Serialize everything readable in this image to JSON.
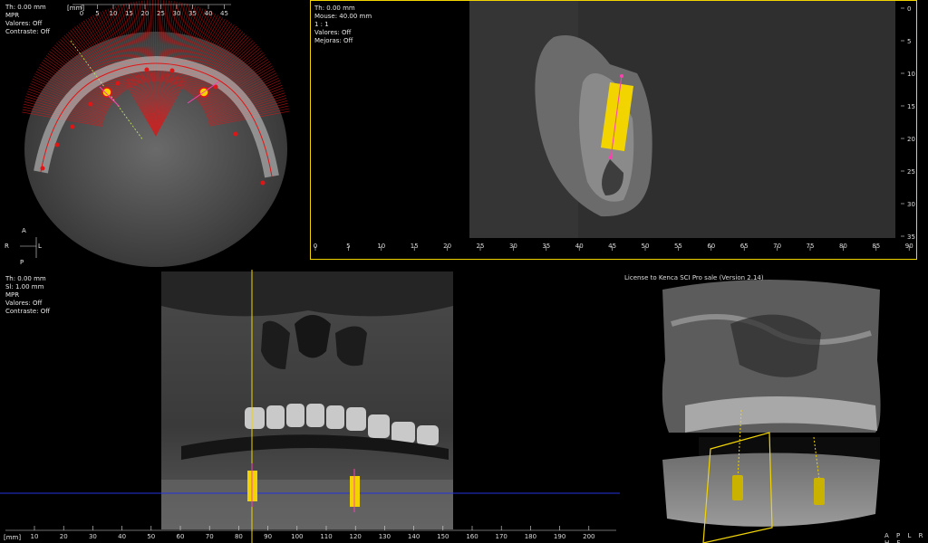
{
  "axial": {
    "info": [
      "Th: 0.00 mm",
      "MPR",
      "Valores: Off",
      "Contraste: Off"
    ],
    "ruler_unit": "[mm]",
    "ruler_ticks": [
      "0",
      "5",
      "10",
      "15",
      "20",
      "25",
      "30",
      "35",
      "40",
      "45"
    ],
    "orientation": {
      "top": "A",
      "left": "R",
      "right": "L",
      "bottom": "P"
    }
  },
  "cross": {
    "info": [
      "Th: 0.00 mm",
      "Mouse: 40.00 mm",
      "1 : 1",
      "Valores: Off",
      "Mejoras: Off"
    ],
    "h_ticks": [
      "0",
      "5",
      "10",
      "15",
      "20",
      "25",
      "30",
      "35",
      "40",
      "45",
      "50",
      "55",
      "60",
      "65",
      "70",
      "75",
      "80",
      "85",
      "90"
    ],
    "v_ticks": [
      "0",
      "5",
      "10",
      "15",
      "20",
      "25",
      "30",
      "35"
    ]
  },
  "pano": {
    "info": [
      "Th: 0.00 mm",
      "Sl: 1.00 mm",
      "MPR",
      "Valores: Off",
      "Contraste: Off"
    ],
    "ruler_unit": "[mm]",
    "ruler_ticks": [
      "10",
      "20",
      "30",
      "40",
      "50",
      "60",
      "70",
      "80",
      "90",
      "100",
      "110",
      "120",
      "130",
      "140",
      "150",
      "160",
      "170",
      "180",
      "190",
      "200"
    ]
  },
  "render3d": {
    "license": "License to Kenca SCI Pro sale (Version 2.14)",
    "orientation": "A P L R H F"
  },
  "colors": {
    "implant": "#f2d500",
    "axis": "#ff3fb0",
    "frame": "#f2d500",
    "curve": "#e01515",
    "ref_line": "#2233dd"
  }
}
